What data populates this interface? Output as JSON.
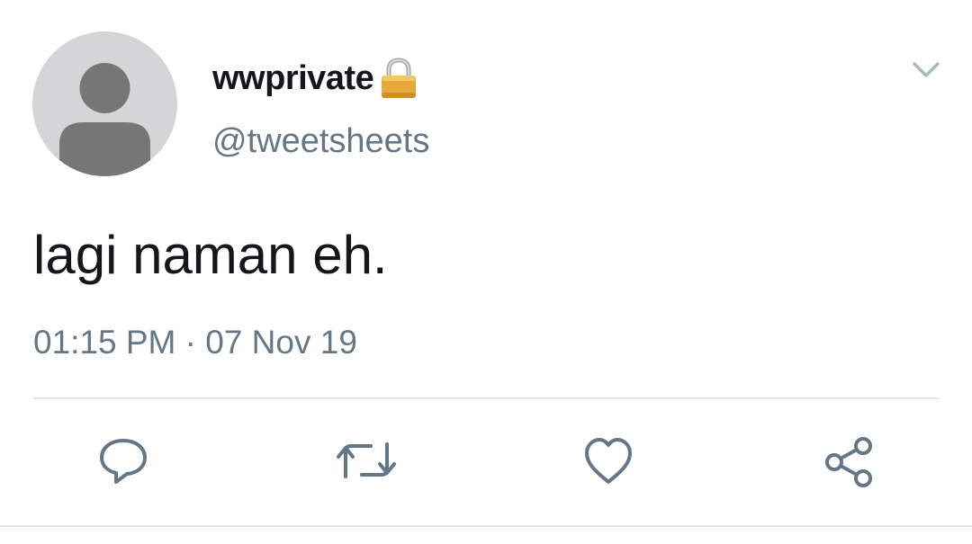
{
  "tweet": {
    "display_name": "wwprivate",
    "handle": "@tweetsheets",
    "text": "lagi naman eh.",
    "timestamp": "01:15 PM · 07 Nov 19",
    "icons": {
      "avatar": "default-avatar-icon",
      "verified_lock": "lock-icon",
      "menu": "chevron-down-icon"
    }
  },
  "actions": [
    {
      "name": "reply",
      "icon": "reply-icon"
    },
    {
      "name": "retweet",
      "icon": "retweet-icon"
    },
    {
      "name": "like",
      "icon": "heart-icon"
    },
    {
      "name": "share",
      "icon": "share-icon"
    }
  ],
  "colors": {
    "text_primary": "#14171a",
    "text_secondary": "#657786",
    "icon": "#657786",
    "divider": "#e1e8ed",
    "avatar_bg": "#d3d5d7",
    "avatar_fg": "#7b7b7b",
    "lock_gold": "#e6a83a"
  }
}
